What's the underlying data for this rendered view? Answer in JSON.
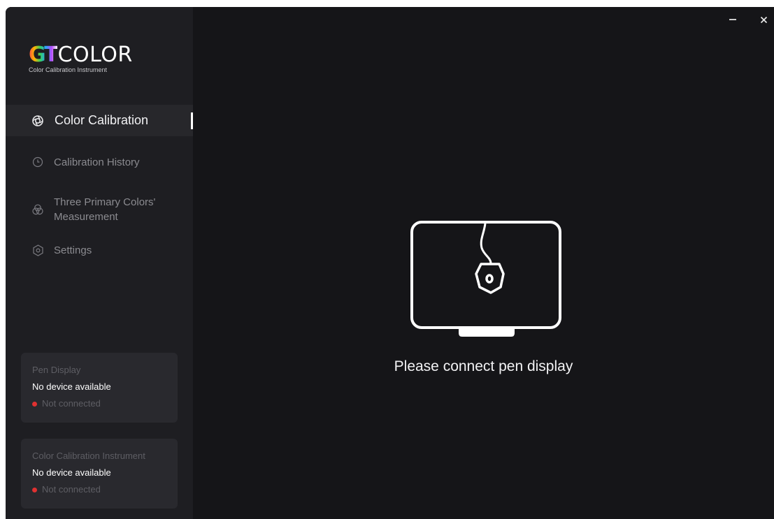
{
  "app": {
    "logo_mark": "GT",
    "logo_text": "COLOR",
    "logo_subtitle": "Color Calibration Instrument"
  },
  "sidebar": {
    "items": [
      {
        "label": "Color Calibration",
        "icon": "color-calibration-icon",
        "active": true
      },
      {
        "label": "Calibration History",
        "icon": "clock-icon",
        "active": false
      },
      {
        "label_line1": "Three Primary Colors'",
        "label_line2": "Measurement",
        "icon": "rgb-circles-icon",
        "active": false
      },
      {
        "label": "Settings",
        "icon": "gear-hexagon-icon",
        "active": false
      }
    ]
  },
  "status_cards": {
    "pen_display": {
      "title": "Pen Display",
      "value": "No device available",
      "status": "Not connected",
      "status_color": "#e03131"
    },
    "calibration_instrument": {
      "title": "Color Calibration Instrument",
      "value": "No device available",
      "status": "Not connected",
      "status_color": "#e03131"
    }
  },
  "window_controls": {
    "minimize": "−",
    "close": "×"
  },
  "main": {
    "illustration_icon": "pen-display-with-sensor-icon",
    "message": "Please connect pen display"
  },
  "colors": {
    "background": "#151518",
    "sidebar": "#1e1e22",
    "active_item": "#27272b",
    "card": "#29292e",
    "accent_white": "#ffffff",
    "disconnected_dot": "#e03131"
  }
}
